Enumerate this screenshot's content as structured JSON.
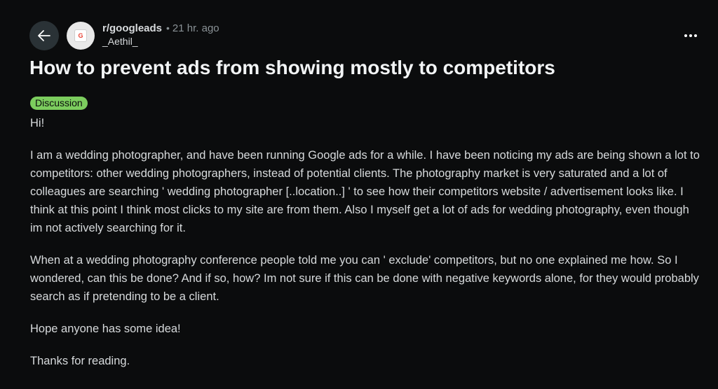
{
  "header": {
    "subreddit": "r/googleads",
    "separator": "•",
    "timestamp": "21 hr. ago",
    "username": "_Aethil_",
    "avatar_letter": "G"
  },
  "post": {
    "title": "How to prevent ads from showing mostly to competitors",
    "flair": "Discussion",
    "paragraphs": [
      "Hi!",
      "I am a wedding photographer, and have been running Google ads for a while. I have been noticing my ads are being shown a lot to competitors: other wedding photographers, instead of potential clients. The photography market is very saturated and a lot of colleagues are searching ' wedding photographer [..location..] ' to see how their competitors website / advertisement looks like. I think at this point I think most clicks to my site are from them. Also I myself get a lot of ads for wedding photography, even though im not actively searching for it.",
      "When at a wedding photography conference people told me you can ' exclude' competitors, but no one explained me how. So I wondered, can this be done? And if so, how? Im not sure if this can be done with negative keywords alone, for they would probably search as if pretending to be a client.",
      "Hope anyone has some idea!",
      "Thanks for reading."
    ]
  },
  "icons": {
    "back": "arrow-left-icon",
    "more": "more-horizontal-icon"
  },
  "colors": {
    "background": "#0b0c0d",
    "text": "#d7dadc",
    "flair_bg": "#7ccd5e",
    "back_button_bg": "#2a3236"
  }
}
